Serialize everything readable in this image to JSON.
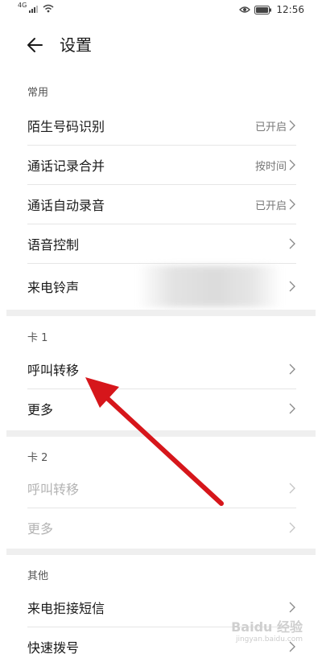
{
  "status_bar": {
    "signal_label": "4G",
    "time": "12:56"
  },
  "header": {
    "title": "设置",
    "back_icon": "arrow-left-icon"
  },
  "sections": [
    {
      "label": "常用",
      "items": [
        {
          "label": "陌生号码识别",
          "value": "已开启"
        },
        {
          "label": "通话记录合并",
          "value": "按时间"
        },
        {
          "label": "通话自动录音",
          "value": "已开启"
        },
        {
          "label": "语音控制",
          "value": ""
        },
        {
          "label": "来电铃声",
          "value": ""
        }
      ]
    },
    {
      "label": "卡 1",
      "items": [
        {
          "label": "呼叫转移",
          "value": ""
        },
        {
          "label": "更多",
          "value": ""
        }
      ]
    },
    {
      "label": "卡 2",
      "items": [
        {
          "label": "呼叫转移",
          "value": "",
          "disabled": true
        },
        {
          "label": "更多",
          "value": "",
          "disabled": true
        }
      ]
    },
    {
      "label": "其他",
      "items": [
        {
          "label": "来电拒接短信",
          "value": ""
        },
        {
          "label": "快速拨号",
          "value": ""
        }
      ]
    }
  ],
  "colors": {
    "annotation_arrow": "#d6161b",
    "disabled_text": "#b3b3b3",
    "section_band": "#efefef"
  },
  "watermark": {
    "brand": "Baidu 经验",
    "url": "jingyan.baidu.com"
  }
}
